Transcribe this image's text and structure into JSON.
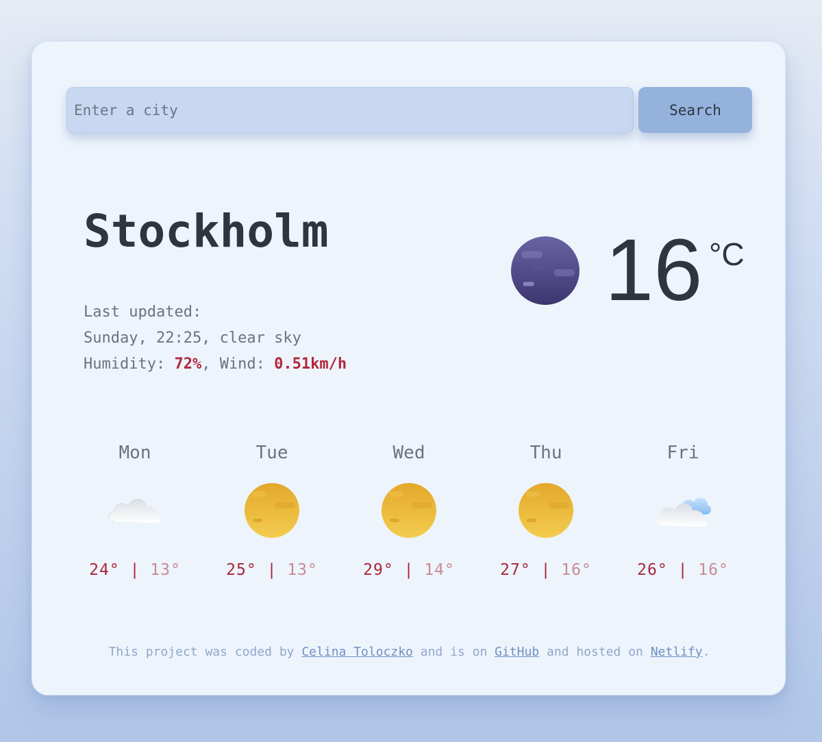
{
  "search": {
    "placeholder": "Enter a city",
    "button_label": "Search"
  },
  "current": {
    "city": "Stockholm",
    "updated_label": "Last updated:",
    "updated_value": "Sunday, 22:25, clear sky",
    "humidity_label": "Humidity: ",
    "humidity_value": "72%",
    "wind_label": ", Wind: ",
    "wind_value": "0.51km/h",
    "temperature": "16",
    "unit": "°C",
    "icon": "clear-night-icon"
  },
  "forecast": [
    {
      "day": "Mon",
      "max": "24°",
      "sep": "|",
      "min": "13°",
      "icon": "cloud-icon"
    },
    {
      "day": "Tue",
      "max": "25°",
      "sep": "|",
      "min": "13°",
      "icon": "sun-icon"
    },
    {
      "day": "Wed",
      "max": "29°",
      "sep": "|",
      "min": "14°",
      "icon": "sun-icon"
    },
    {
      "day": "Thu",
      "max": "27°",
      "sep": "|",
      "min": "16°",
      "icon": "sun-icon"
    },
    {
      "day": "Fri",
      "max": "26°",
      "sep": "|",
      "min": "16°",
      "icon": "partly-cloudy-icon"
    }
  ],
  "footer": {
    "part1": "This project was coded by ",
    "author_link": "Celina Toloczko",
    "part2": " and is on ",
    "github_link": "GitHub",
    "part3": " and hosted on ",
    "netlify_link": "Netlify",
    "part4": "."
  },
  "colors": {
    "accent": "#b0283a",
    "card": "#eef4fc",
    "input": "#c8d8f0",
    "button": "#95b2dd"
  }
}
